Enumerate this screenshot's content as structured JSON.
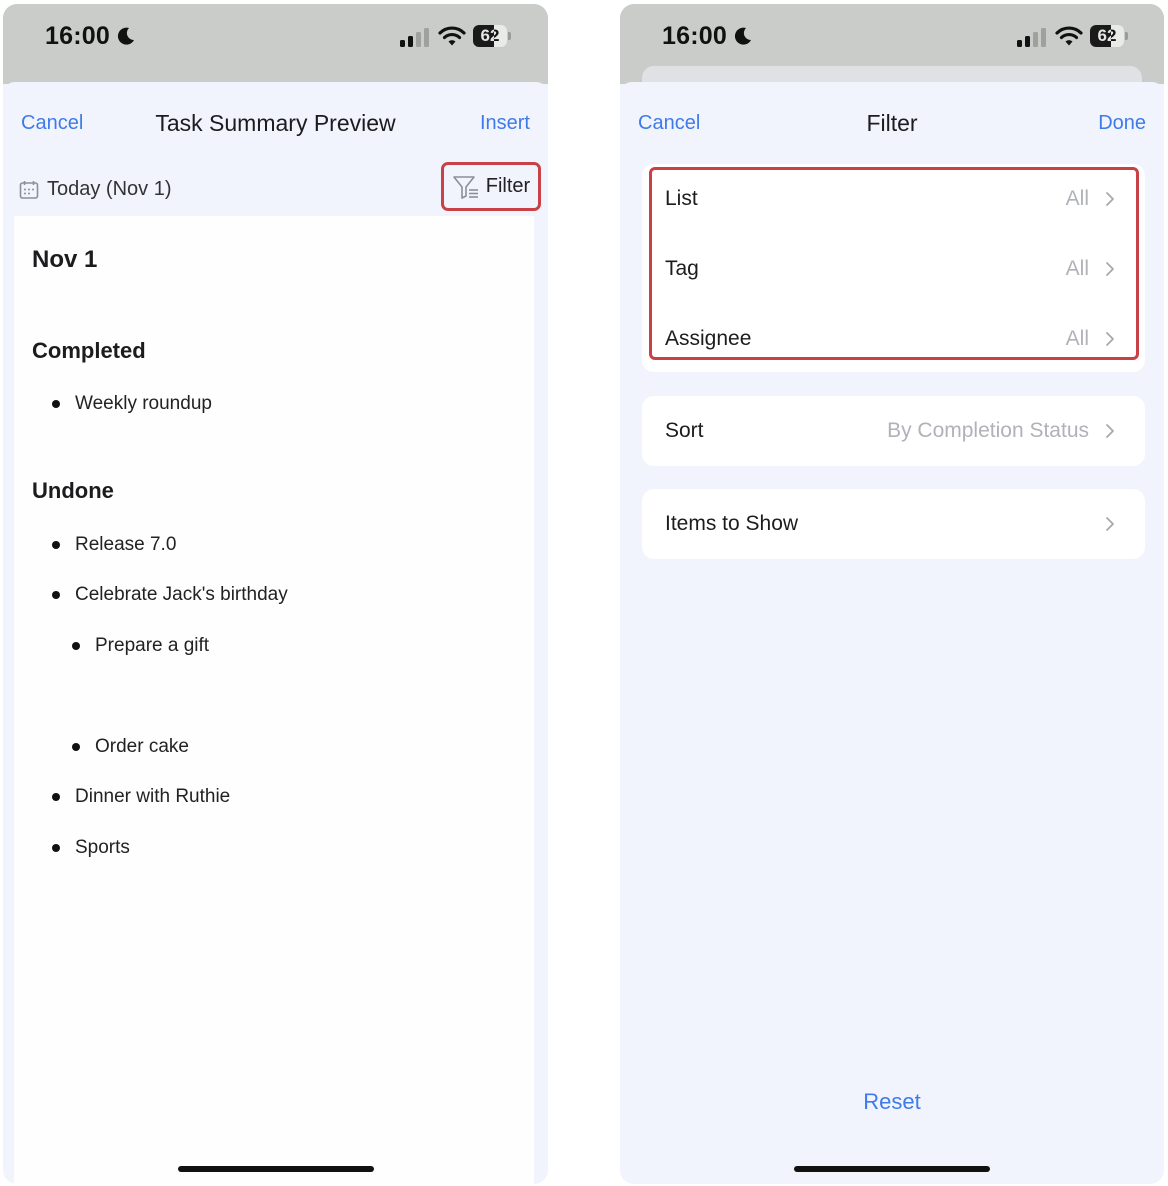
{
  "status_bar": {
    "time": "16:00",
    "battery": "62",
    "battery_level": 0.62
  },
  "left": {
    "nav": {
      "cancel": "Cancel",
      "title": "Task Summary Preview",
      "insert": "Insert"
    },
    "date_label": "Today (Nov 1)",
    "filter_label": "Filter",
    "preview": {
      "date_heading": "Nov 1",
      "completed_heading": "Completed",
      "completed_items": [
        "Weekly roundup"
      ],
      "undone_heading": "Undone",
      "undone_items": [
        {
          "text": "Release 7.0",
          "level": 1
        },
        {
          "text": "Celebrate Jack's birthday",
          "level": 1
        },
        {
          "text": "Prepare a gift",
          "level": 2
        },
        {
          "text": "Order cake",
          "level": 2
        },
        {
          "text": "Dinner with Ruthie",
          "level": 1
        },
        {
          "text": "Sports",
          "level": 1
        }
      ]
    }
  },
  "right": {
    "nav": {
      "cancel": "Cancel",
      "title": "Filter",
      "done": "Done"
    },
    "filter_rows": [
      {
        "label": "List",
        "value": "All"
      },
      {
        "label": "Tag",
        "value": "All"
      },
      {
        "label": "Assignee",
        "value": "All"
      }
    ],
    "sort": {
      "label": "Sort",
      "value": "By Completion Status"
    },
    "items_to_show": {
      "label": "Items to Show"
    },
    "reset": "Reset"
  },
  "colors": {
    "accent": "#3f7be8",
    "highlight": "#c84146",
    "background": "#f1f4fd"
  },
  "icons": [
    "moon-icon",
    "signal-icon",
    "wifi-icon",
    "battery-icon",
    "calendar-icon",
    "filter-icon",
    "chevron-right-icon"
  ]
}
